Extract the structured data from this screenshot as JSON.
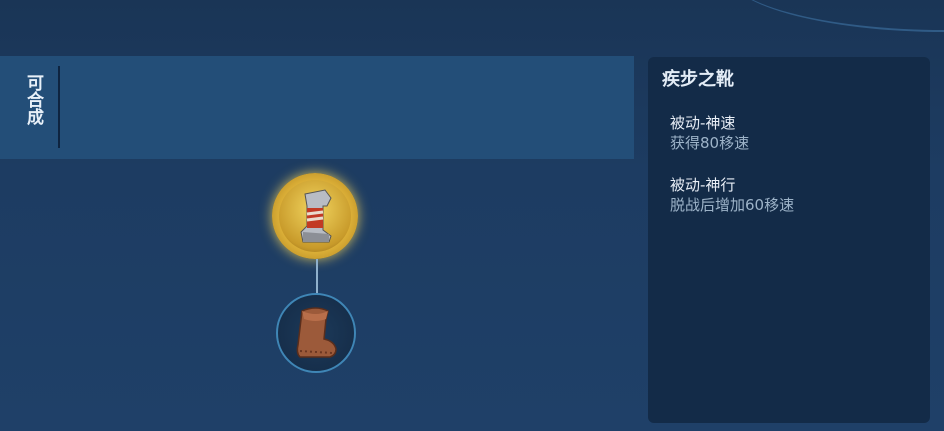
{
  "recipe": {
    "label": "可合成"
  },
  "tree": {
    "top_item_icon": "boots-upgraded-icon",
    "bottom_item_icon": "basic-boots-icon"
  },
  "detail": {
    "item_name": "疾步之靴",
    "effects": [
      {
        "title": "被动-神速",
        "desc": "获得80移速"
      },
      {
        "title": "被动-神行",
        "desc": "脱战后增加60移速"
      }
    ]
  },
  "colors": {
    "bar": "#234e78",
    "panel": "#132b48",
    "gold_ring": "#e0b43a",
    "blue_ring": "#3f86b6"
  }
}
